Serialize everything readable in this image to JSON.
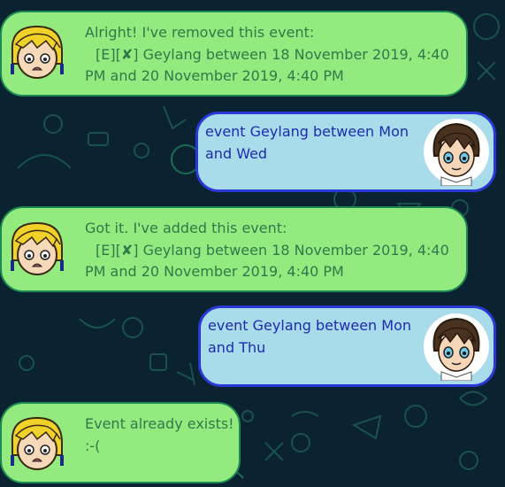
{
  "messages": [
    {
      "sender": "bot",
      "lines": [
        "Alright! I've removed this event:",
        "[E][✘] Geylang between 18 November 2019, 4:40",
        "PM and 20 November 2019, 4:40 PM"
      ]
    },
    {
      "sender": "user",
      "lines": [
        "event Geylang between Mon",
        "and Wed"
      ]
    },
    {
      "sender": "bot",
      "lines": [
        "Got it. I've added this event:",
        "[E][✘] Geylang between 18 November 2019, 4:40",
        "PM and 20 November 2019, 4:40 PM"
      ]
    },
    {
      "sender": "user",
      "lines": [
        "event Geylang between Mon",
        "and Thu"
      ]
    },
    {
      "sender": "bot",
      "lines": [
        "Event already exists!",
        ":-("
      ]
    }
  ],
  "avatars": {
    "bot": "blonde-bot-avatar",
    "user": "brown-hair-user-avatar"
  },
  "colors": {
    "background": "#0b2230",
    "bot_bubble": "#93ea7e",
    "bot_text": "#2f7a4a",
    "user_bubble": "#a9dcea",
    "user_border": "#2a39d6",
    "user_text": "#1d2bb0"
  }
}
